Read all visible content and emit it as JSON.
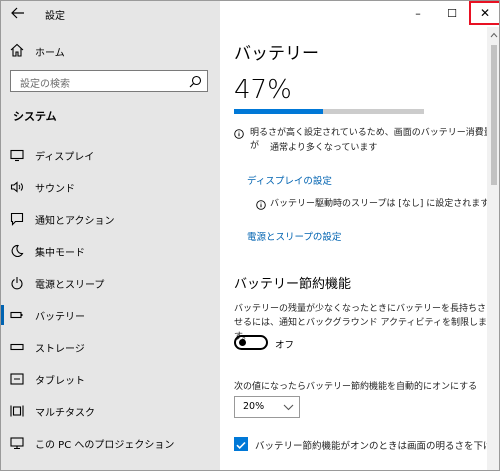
{
  "window": {
    "app_title": "設定",
    "controls": {
      "minimize": "–",
      "maximize": "☐",
      "close": "✕"
    }
  },
  "sidebar": {
    "home_label": "ホーム",
    "search_placeholder": "設定の検索",
    "section_title": "システム",
    "items": [
      {
        "label": "ディスプレイ",
        "icon": "monitor-icon"
      },
      {
        "label": "サウンド",
        "icon": "speaker-icon"
      },
      {
        "label": "通知とアクション",
        "icon": "notification-icon"
      },
      {
        "label": "集中モード",
        "icon": "moon-icon"
      },
      {
        "label": "電源とスリープ",
        "icon": "power-icon"
      },
      {
        "label": "バッテリー",
        "icon": "battery-icon",
        "selected": true
      },
      {
        "label": "ストレージ",
        "icon": "storage-icon"
      },
      {
        "label": "タブレット",
        "icon": "tablet-icon"
      },
      {
        "label": "マルチタスク",
        "icon": "multitask-icon"
      },
      {
        "label": "この PC へのプロジェクション",
        "icon": "projection-icon"
      }
    ]
  },
  "main": {
    "title": "バッテリー",
    "percent_text": "47%",
    "percent_value": 0.47,
    "info1_line1": "明るさが高く設定されているため、画面のバッテリー消費量が",
    "info1_line2": "通常より多くなっています",
    "display_link": "ディスプレイの設定",
    "info2": "バッテリー駆動時のスリープは [なし] に設定されます",
    "power_link": "電源とスリープの設定",
    "saver_title": "バッテリー節約機能",
    "saver_desc": "バッテリーの残量が少なくなったときにバッテリーを長持ちさせるには、通知とバックグラウンド アクティビティを制限します。",
    "toggle_state": "オフ",
    "auto_label": "次の値になったらバッテリー節約機能を自動的にオンにする",
    "auto_value": "20%",
    "checkbox_label": "バッテリー節約機能がオンのときは画面の明るさを下げる",
    "checkbox_checked": true
  },
  "colors": {
    "accent": "#0078d7",
    "link": "#0063b1",
    "close_border": "#e81123",
    "sidebar_bg": "#e6e6e6"
  }
}
